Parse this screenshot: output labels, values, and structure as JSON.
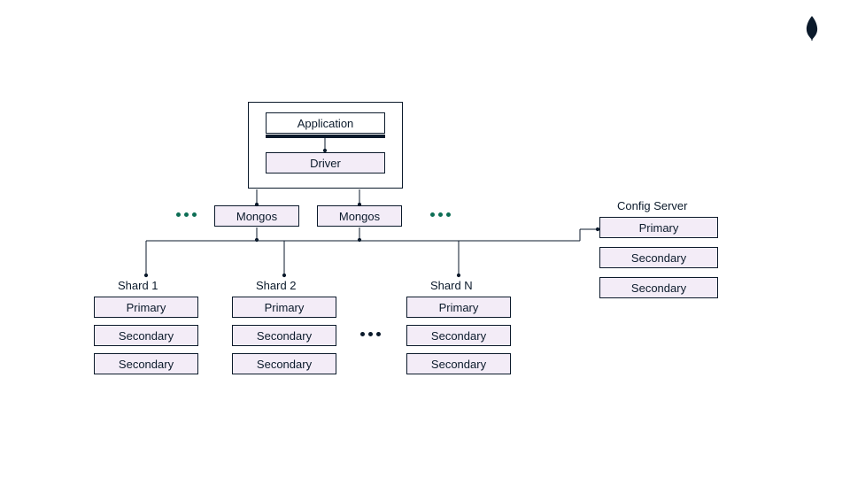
{
  "logo": {
    "name": "mongodb-leaf-icon",
    "color": "#0b1a2b"
  },
  "app_group": {
    "application_label": "Application",
    "driver_label": "Driver"
  },
  "routers": {
    "left_label": "Mongos",
    "right_label": "Mongos"
  },
  "config_server": {
    "title": "Config Server",
    "members": [
      "Primary",
      "Secondary",
      "Secondary"
    ]
  },
  "shards": [
    {
      "title": "Shard 1",
      "members": [
        "Primary",
        "Secondary",
        "Secondary"
      ]
    },
    {
      "title": "Shard 2",
      "members": [
        "Primary",
        "Secondary",
        "Secondary"
      ]
    },
    {
      "title": "Shard N",
      "members": [
        "Primary",
        "Secondary",
        "Secondary"
      ]
    }
  ],
  "colors": {
    "box_fill": "#f3ecf7",
    "line": "#0b1a2b",
    "accent_dots": "#0d6e55"
  }
}
